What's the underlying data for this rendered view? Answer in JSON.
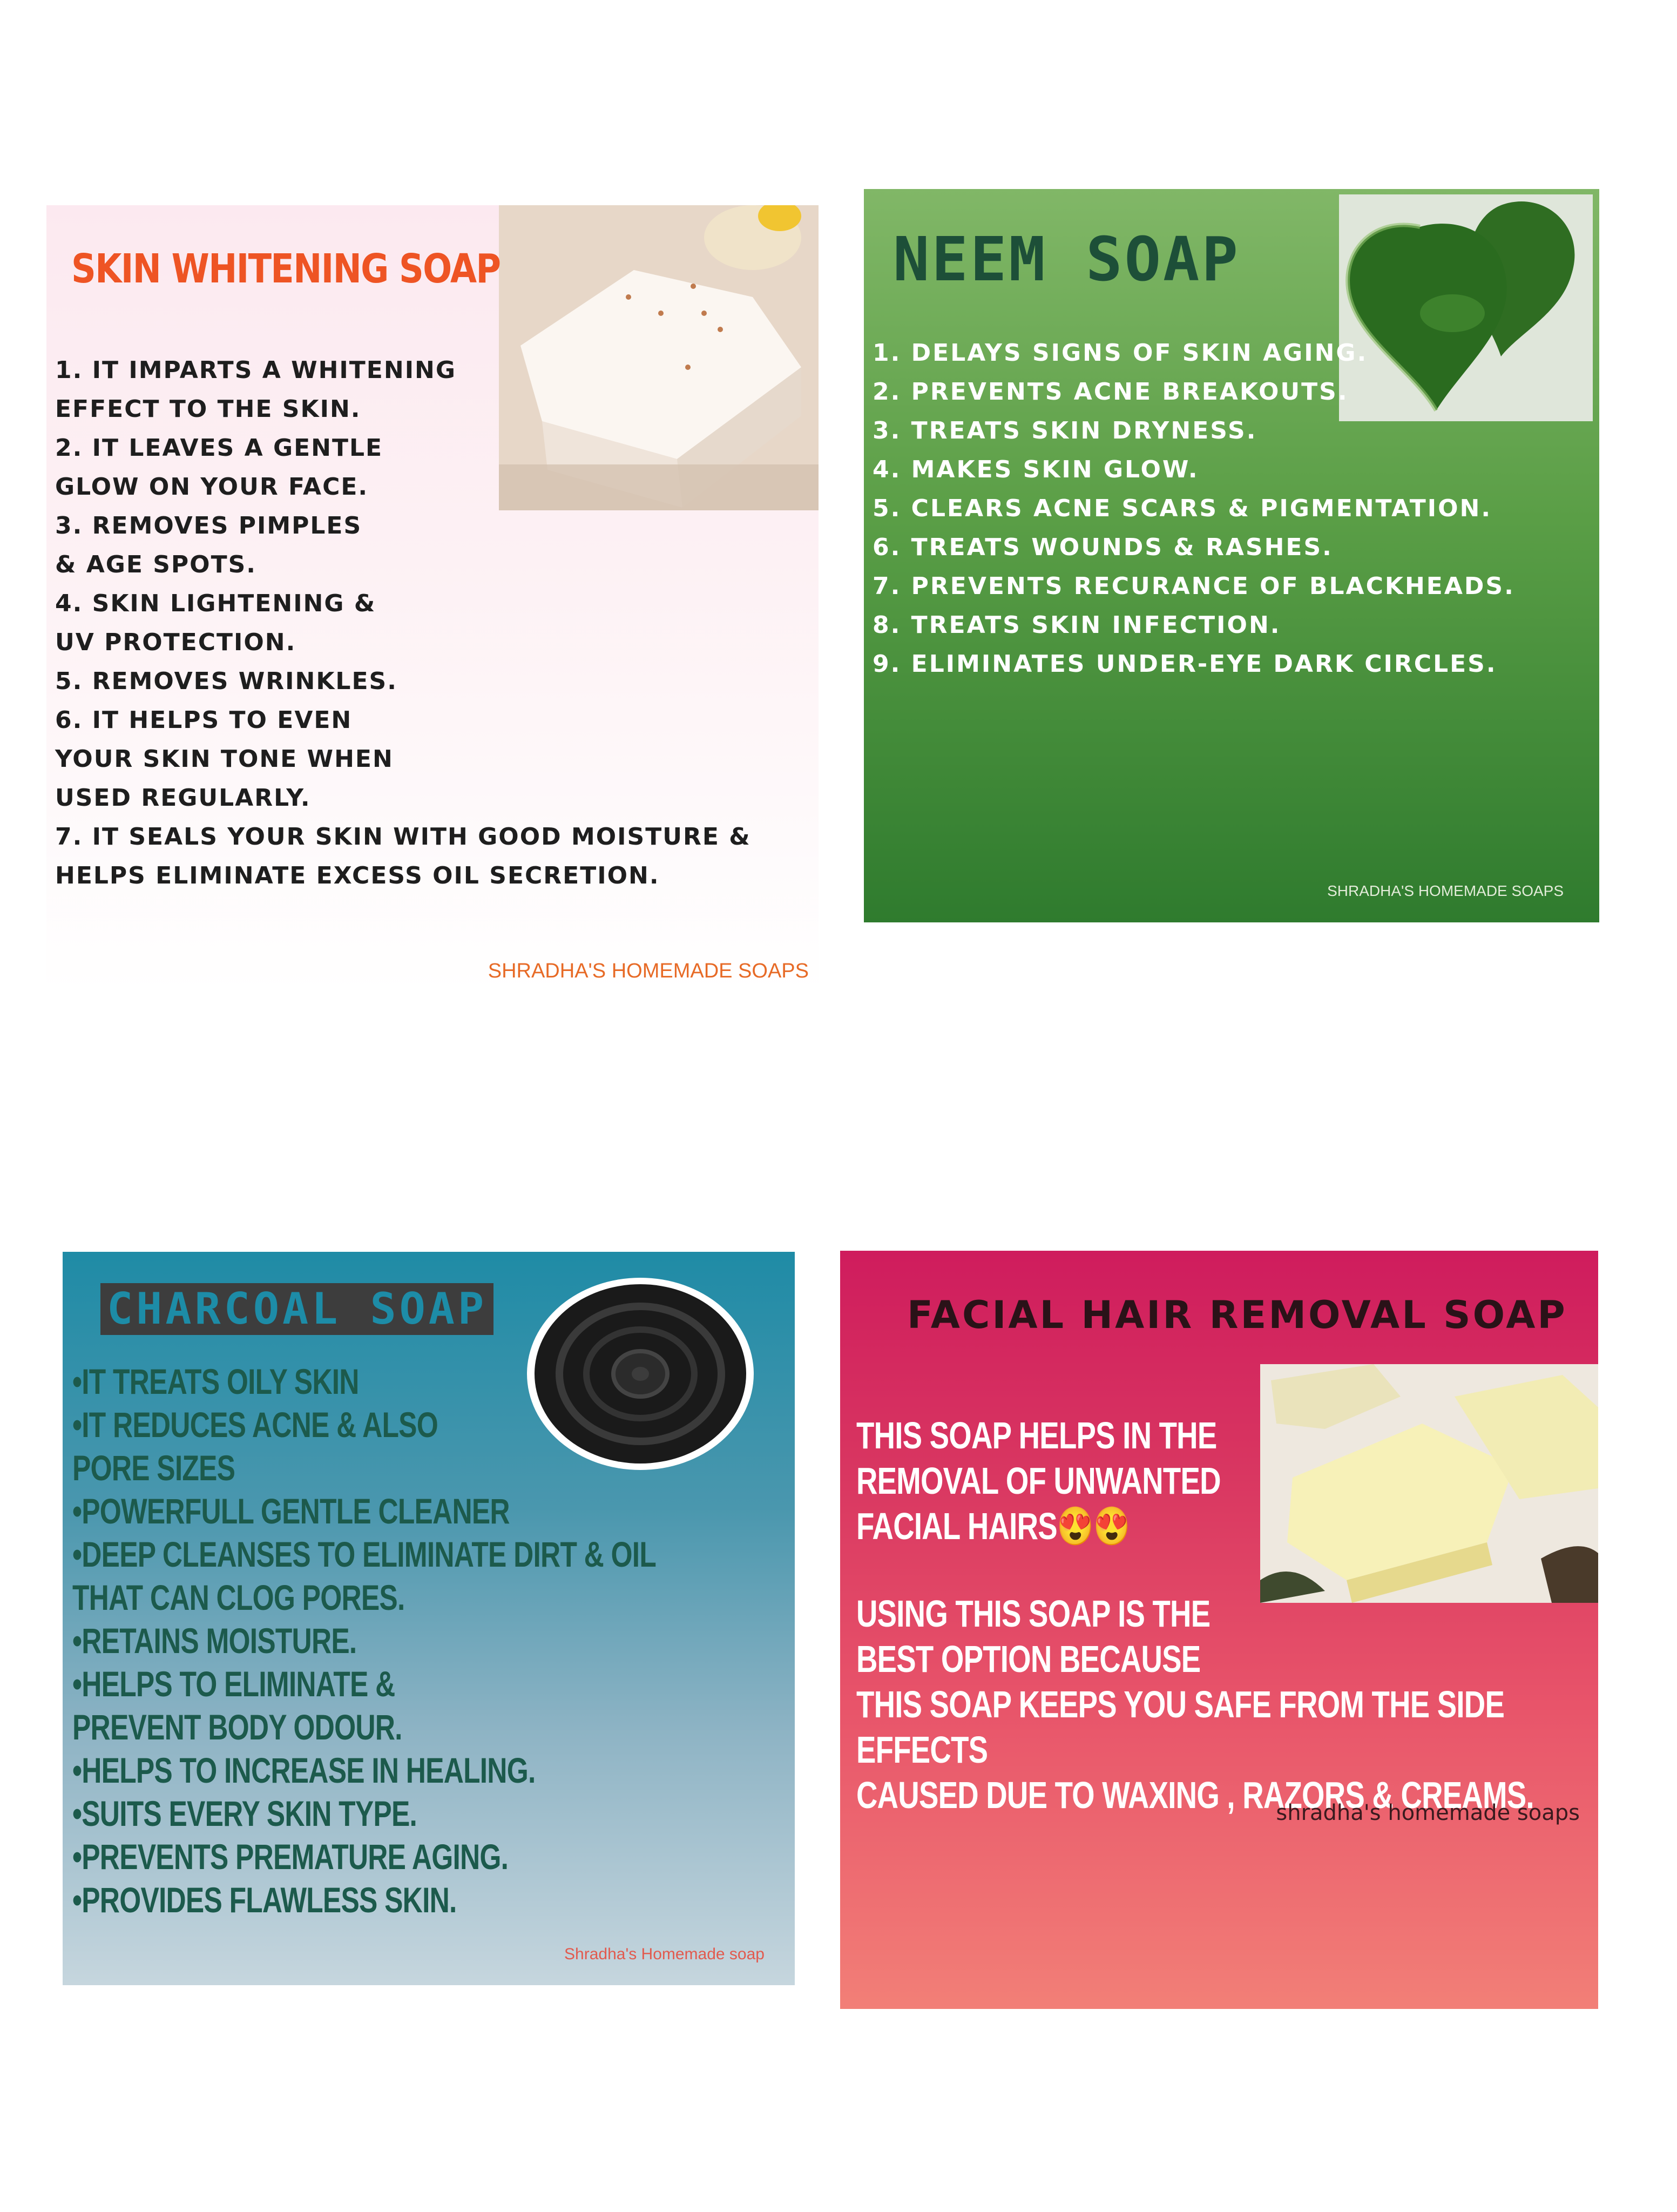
{
  "cards": {
    "skin_whitening": {
      "title": "SKIN WHITENING SOAP",
      "points": [
        "1. IT IMPARTS A WHITENING",
        "EFFECT TO THE SKIN.",
        "2. IT LEAVES A GENTLE",
        " GLOW ON YOUR FACE.",
        "3. REMOVES PIMPLES",
        " & AGE SPOTS.",
        "4. SKIN LIGHTENING &",
        " UV PROTECTION.",
        "5. REMOVES WRINKLES.",
        "6. IT HELPS TO EVEN",
        " YOUR SKIN TONE WHEN",
        " USED REGULARLY.",
        "7. IT SEALS YOUR SKIN WITH GOOD MOISTURE &",
        " HELPS ELIMINATE EXCESS OIL SECRETION."
      ],
      "brand": "SHRADHA'S HOMEMADE SOAPS",
      "photo_icon": "white-soap-bar-photo"
    },
    "neem": {
      "title": "NEEM SOAP",
      "points": [
        "1. DELAYS SIGNS OF SKIN AGING.",
        "2. PREVENTS ACNE BREAKOUTS.",
        "3. TREATS SKIN DRYNESS.",
        "4. MAKES SKIN GLOW.",
        "5. CLEARS ACNE SCARS & PIGMENTATION.",
        "6. TREATS WOUNDS & RASHES.",
        "7. PREVENTS RECURANCE OF BLACKHEADS.",
        "8. TREATS SKIN INFECTION.",
        "9. ELIMINATES UNDER-EYE DARK CIRCLES."
      ],
      "brand": "SHRADHA'S HOMEMADE SOAPS",
      "photo_icon": "green-heart-soap-photo"
    },
    "charcoal": {
      "title": "CHARCOAL SOAP",
      "points": [
        "•IT TREATS OILY SKIN",
        "•IT REDUCES ACNE & ALSO",
        "PORE SIZES",
        "•POWERFULL GENTLE CLEANER",
        "•DEEP CLEANSES TO ELIMINATE DIRT & OIL",
        "THAT CAN CLOG PORES.",
        "•RETAINS MOISTURE.",
        "•HELPS TO ELIMINATE &",
        "PREVENT BODY ODOUR.",
        "•HELPS TO INCREASE IN HEALING.",
        "•SUITS EVERY SKIN TYPE.",
        "•PREVENTS PREMATURE AGING.",
        "•PROVIDES FLAWLESS SKIN."
      ],
      "brand": "Shradha's Homemade soap",
      "photo_icon": "black-flower-soap-photo"
    },
    "facial_hair": {
      "title": "FACIAL HAIR REMOVAL SOAP",
      "para1": "THIS SOAP HELPS IN THE\n REMOVAL OF UNWANTED\n FACIAL HAIRS😍😍",
      "para2": "USING THIS SOAP IS THE\n BEST OPTION BECAUSE\n THIS SOAP KEEPS YOU SAFE FROM THE SIDE EFFECTS\n CAUSED DUE TO WAXING , RAZORS & CREAMS.",
      "brand": "shradha's homemade soaps",
      "photo_icon": "yellow-soap-bars-photo"
    }
  }
}
